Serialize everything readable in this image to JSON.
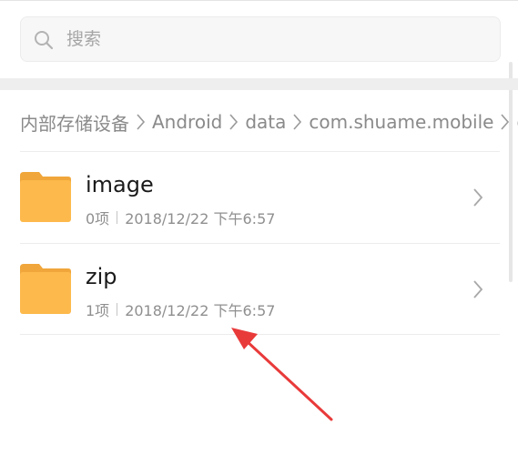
{
  "search": {
    "placeholder": "搜索",
    "icon": "search-icon"
  },
  "breadcrumb": [
    "内部存储设备",
    "Android",
    "data",
    "com.shuame.mobile",
    "c"
  ],
  "files": [
    {
      "name": "image",
      "count": "0项",
      "date": "2018/12/22 下午6:57",
      "icon": "folder-icon"
    },
    {
      "name": "zip",
      "count": "1项",
      "date": "2018/12/22 下午6:57",
      "icon": "folder-icon"
    }
  ],
  "colors": {
    "folder": "#fdb94b",
    "folder_tab": "#f0a63a",
    "annotation_arrow": "#e93a3a"
  }
}
